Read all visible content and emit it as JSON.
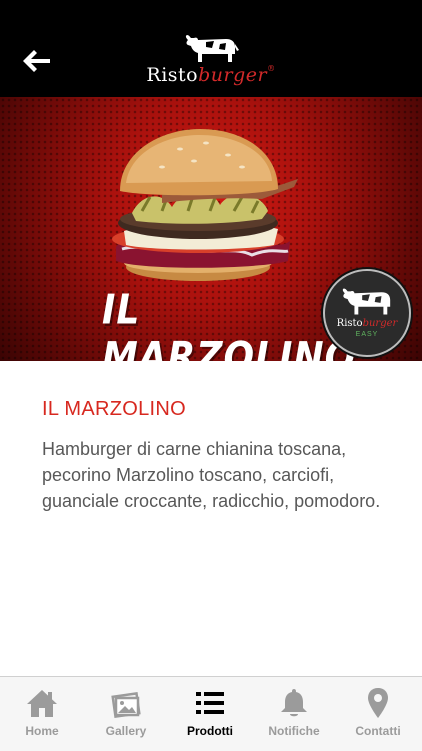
{
  "header": {
    "logo_part1": "Risto",
    "logo_part2": "burger",
    "logo_mark": "®"
  },
  "banner": {
    "title": "IL MARZOLINO",
    "badge_part1": "Risto",
    "badge_part2": "burger",
    "badge_sub": "EASY"
  },
  "product": {
    "title": "IL MARZOLINO",
    "description": "Hamburger di carne chianina toscana, pecorino Marzolino toscano, carciofi, guanciale croccante, radicchio, pomodoro."
  },
  "tabs": [
    {
      "label": "Home",
      "icon": "home-icon",
      "active": false
    },
    {
      "label": "Gallery",
      "icon": "gallery-icon",
      "active": false
    },
    {
      "label": "Prodotti",
      "icon": "list-icon",
      "active": true
    },
    {
      "label": "Notifiche",
      "icon": "bell-icon",
      "active": false
    },
    {
      "label": "Contatti",
      "icon": "location-pin-icon",
      "active": false
    }
  ],
  "colors": {
    "accent_red": "#d7281f",
    "topbar": "#000000",
    "tab_inactive": "#9b9b9b",
    "tab_active": "#000000"
  }
}
